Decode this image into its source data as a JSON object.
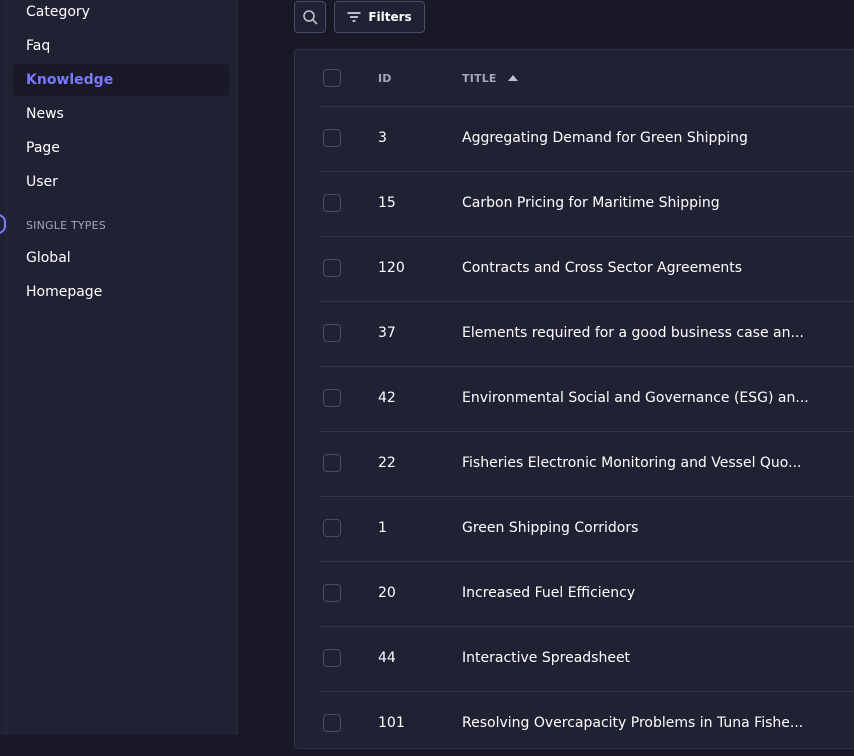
{
  "sidebar": {
    "collection_items": [
      {
        "label": "Category",
        "active": false
      },
      {
        "label": "Faq",
        "active": false
      },
      {
        "label": "Knowledge",
        "active": true
      },
      {
        "label": "News",
        "active": false
      },
      {
        "label": "Page",
        "active": false
      },
      {
        "label": "User",
        "active": false
      }
    ],
    "single_types_label": "SINGLE TYPES",
    "single_type_items": [
      {
        "label": "Global"
      },
      {
        "label": "Homepage"
      }
    ]
  },
  "toolbar": {
    "search_icon": "search-icon",
    "filters_icon": "filter-icon",
    "filters_label": "Filters"
  },
  "table": {
    "headers": {
      "id": "ID",
      "title": "TITLE",
      "sort_icon": "sort-ascending-icon"
    },
    "rows": [
      {
        "id": "3",
        "title": "Aggregating Demand for Green Shipping"
      },
      {
        "id": "15",
        "title": "Carbon Pricing for Maritime Shipping"
      },
      {
        "id": "120",
        "title": "Contracts and Cross Sector Agreements"
      },
      {
        "id": "37",
        "title": "Elements required for a good business case an..."
      },
      {
        "id": "42",
        "title": "Environmental Social and Governance (ESG) an..."
      },
      {
        "id": "22",
        "title": "Fisheries Electronic Monitoring and Vessel Quo..."
      },
      {
        "id": "1",
        "title": "Green Shipping Corridors"
      },
      {
        "id": "20",
        "title": "Increased Fuel Efficiency"
      },
      {
        "id": "44",
        "title": "Interactive Spreadsheet"
      },
      {
        "id": "101",
        "title": "Resolving Overcapacity Problems in Tuna Fishe..."
      }
    ]
  },
  "colors": {
    "background": "#181826",
    "panel": "#212134",
    "border": "#32324d",
    "accent": "#7b79ff",
    "muted_text": "#a5a5ba"
  }
}
